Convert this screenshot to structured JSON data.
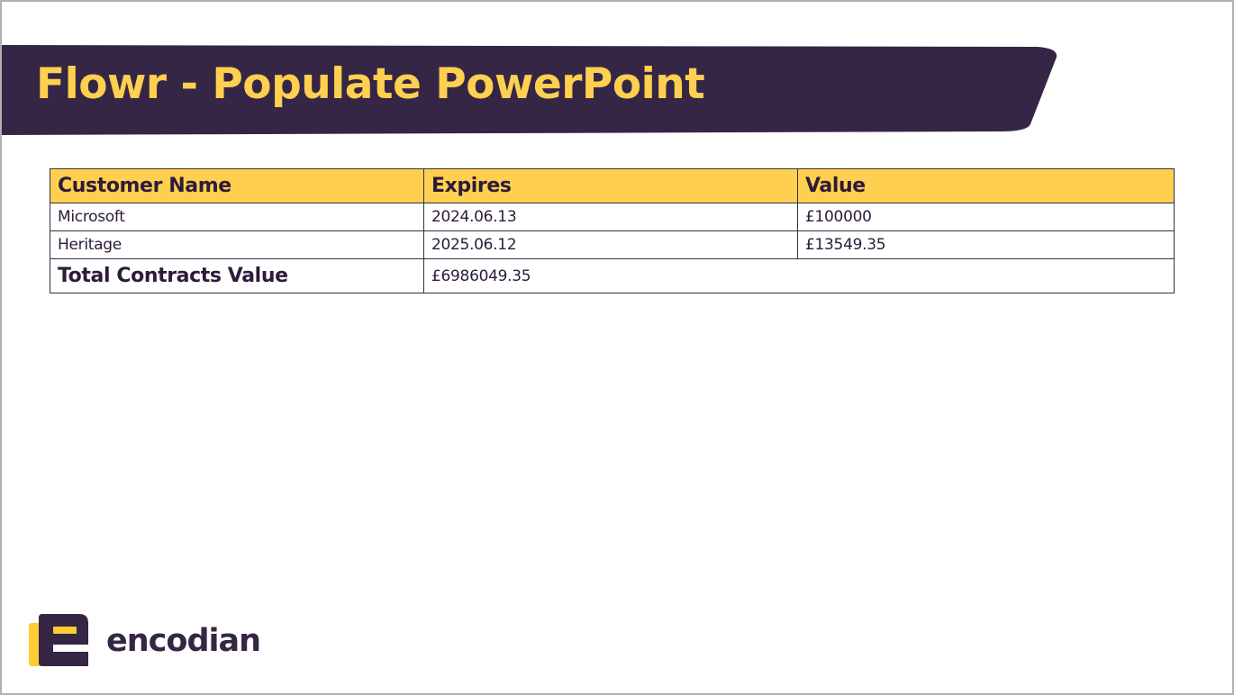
{
  "slide": {
    "title": "Flowr - Populate PowerPoint"
  },
  "table": {
    "headers": [
      "Customer Name",
      "Expires",
      "Value"
    ],
    "rows": [
      [
        "Microsoft",
        "2024.06.13",
        "£100000"
      ],
      [
        "Heritage",
        "2025.06.12",
        "£13549.35"
      ]
    ],
    "total": {
      "label": "Total Contracts Value",
      "value": "£6986049.35"
    }
  },
  "logo": {
    "wordmark": "encodian",
    "icon": "encodian-e-logo-icon"
  },
  "colors": {
    "banner": "#352645",
    "title_text": "#ffd050",
    "header_fill": "#ffd050",
    "text_dark": "#2d1b3a",
    "border": "#3a2d45",
    "logo_yellow": "#ffcc33"
  }
}
